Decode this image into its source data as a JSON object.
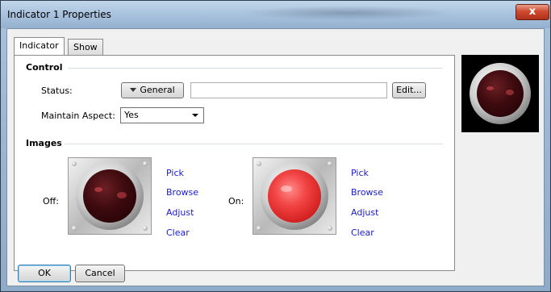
{
  "window": {
    "title": "Indicator 1 Properties",
    "close_glyph": "x"
  },
  "tabs": [
    {
      "label": "Indicator",
      "active": true
    },
    {
      "label": "Show",
      "active": false
    }
  ],
  "control": {
    "group_label": "Control",
    "status_label": "Status:",
    "status_button": "General",
    "status_value": "",
    "edit_button": "Edit...",
    "maintain_aspect_label": "Maintain Aspect:",
    "maintain_aspect_value": "Yes"
  },
  "images": {
    "group_label": "Images",
    "off_label": "Off:",
    "on_label": "On:",
    "off_links": [
      "Pick",
      "Browse",
      "Adjust",
      "Clear"
    ],
    "on_links": [
      "Pick",
      "Browse",
      "Adjust",
      "Clear"
    ]
  },
  "footer": {
    "ok": "OK",
    "cancel": "Cancel"
  },
  "colors": {
    "link": "#1a1acd",
    "lamp_off": "#3c0a0e",
    "lamp_on": "#e83535"
  }
}
